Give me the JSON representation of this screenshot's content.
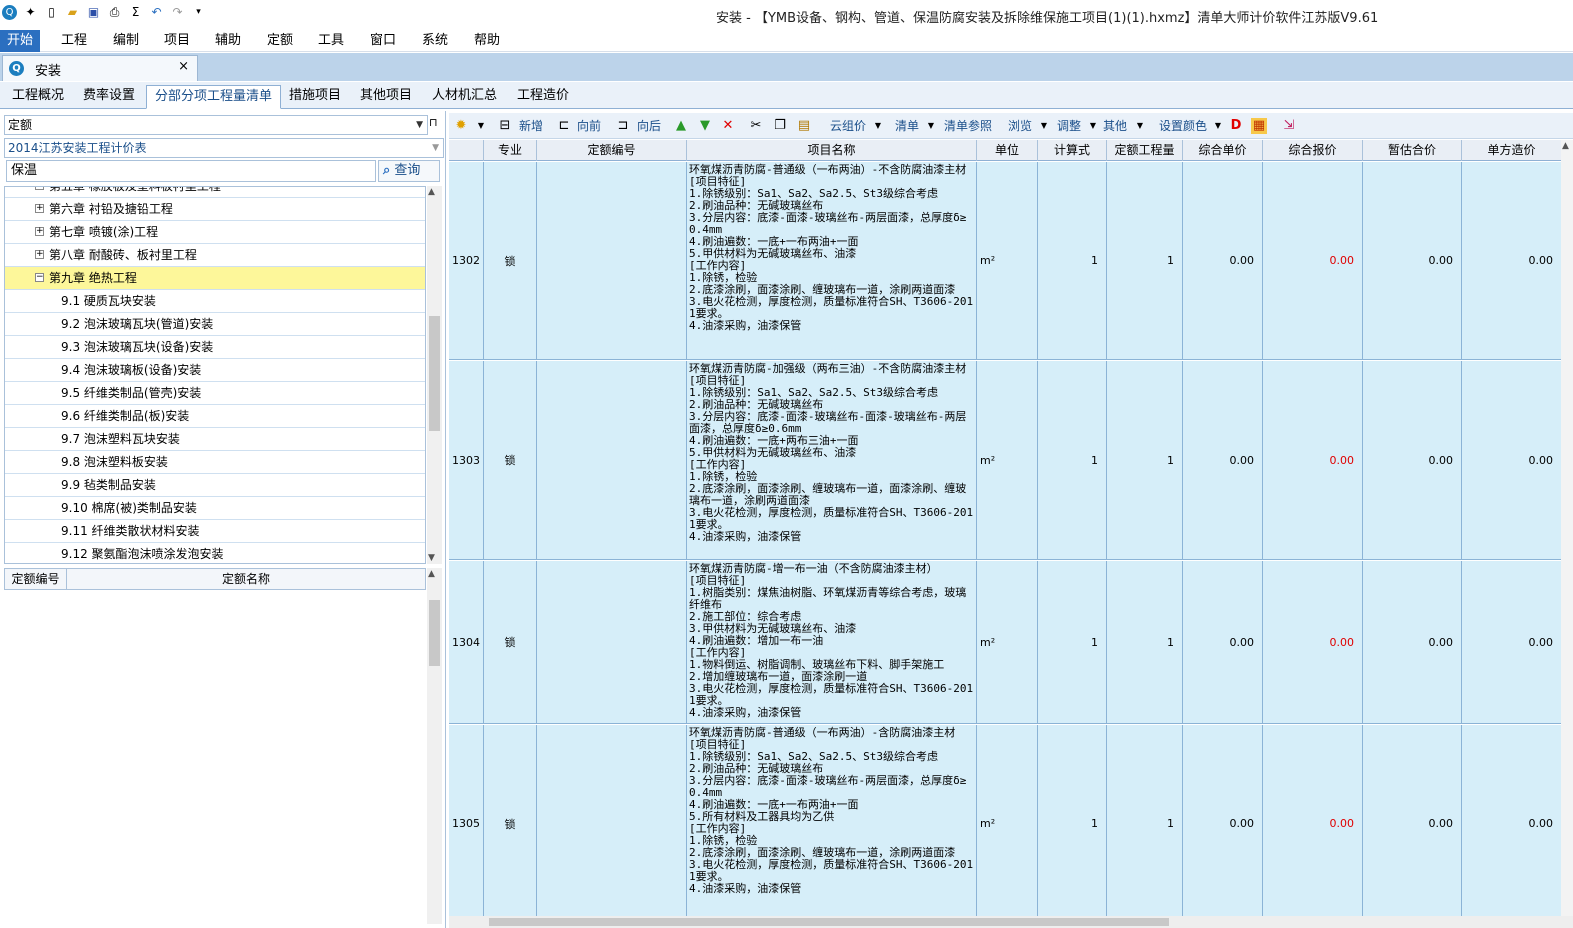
{
  "window": {
    "title": "安装 - 【YMB设备、钢构、管道、保温防腐安装及拆除维保施工项目(1)(1).hxmz】清单大师计价软件江苏版V9.61",
    "quick_access": [
      "app-logo",
      "new-icon",
      "new-doc-icon",
      "open-icon",
      "save-icon",
      "print-icon",
      "sigma-icon",
      "undo-icon",
      "redo-icon",
      "customize-icon"
    ]
  },
  "menu": [
    "开始",
    "工程",
    "编制",
    "项目",
    "辅助",
    "定额",
    "工具",
    "窗口",
    "系统",
    "帮助"
  ],
  "doc_tab": {
    "label": "安装",
    "close": "×"
  },
  "tabs": [
    "工程概况",
    "费率设置",
    "分部分项工程量清单",
    "措施项目",
    "其他项目",
    "人材机汇总",
    "工程造价"
  ],
  "left": {
    "type_combo": "定额",
    "library_combo": "2014江苏安装工程计价表",
    "search_value": "保温",
    "search_button": "查询",
    "tree": [
      {
        "label": "第五章 橡胶板及塑料板衬里工程",
        "level": 0,
        "exp": "+"
      },
      {
        "label": "第六章 衬铅及搪铅工程",
        "level": 0,
        "exp": "+"
      },
      {
        "label": "第七章 喷镀(涂)工程",
        "level": 0,
        "exp": "+"
      },
      {
        "label": "第八章 耐酸砖、板衬里工程",
        "level": 0,
        "exp": "+"
      },
      {
        "label": "第九章 绝热工程",
        "level": 0,
        "exp": "−",
        "selected": true
      },
      {
        "label": "9.1 硬质瓦块安装",
        "level": 1
      },
      {
        "label": "9.2 泡沫玻璃瓦块(管道)安装",
        "level": 1
      },
      {
        "label": "9.3 泡沫玻璃瓦块(设备)安装",
        "level": 1
      },
      {
        "label": "9.4 泡沫玻璃板(设备)安装",
        "level": 1
      },
      {
        "label": "9.5 纤维类制品(管壳)安装",
        "level": 1
      },
      {
        "label": "9.6 纤维类制品(板)安装",
        "level": 1
      },
      {
        "label": "9.7 泡沫塑料瓦块安装",
        "level": 1
      },
      {
        "label": "9.8 泡沫塑料板安装",
        "level": 1
      },
      {
        "label": "9.9 毡类制品安装",
        "level": 1
      },
      {
        "label": "9.10 棉席(被)类制品安装",
        "level": 1
      },
      {
        "label": "9.11 纤维类散状材料安装",
        "level": 1
      },
      {
        "label": "9.12 聚氨酯泡沫喷涂发泡安装",
        "level": 1
      }
    ],
    "quota_headers": [
      "定额编号",
      "定额名称"
    ]
  },
  "toolbar": [
    "新增",
    "向前",
    "向后",
    "云组价",
    "清单",
    "清单参照",
    "浏览",
    "调整",
    "其他",
    "设置颜色"
  ],
  "grid": {
    "headers": [
      "专业",
      "定额编号",
      "项目名称",
      "单位",
      "计算式",
      "定额工程量",
      "综合单价",
      "综合报价",
      "暂估合价",
      "单方造价"
    ],
    "rows": [
      {
        "no": "1302",
        "spec": "锁",
        "code": "",
        "name": "环氧煤沥青防腐-普通级（一布两油）-不含防腐油漆主材\n[项目特征]\n1.除锈级别：Sa1、Sa2、Sa2.5、St3级综合考虑\n2.刷油品种：无碱玻璃丝布\n3.分层内容：底漆-面漆-玻璃丝布-两层面漆，总厚度δ≥0.4mm\n4.刷油遍数：一底+一布两油+一面\n5.甲供材料为无碱玻璃丝布、油漆\n[工作内容]\n1.除锈，检验\n2.底漆涂刷，面漆涂刷、缠玻璃布一道，涂刷两道面漆\n3.电火花检测，厚度检测，质量标准符合SH、T3606-2011要求。\n4.油漆采购，油漆保管",
        "unit": "m²",
        "formula": "1",
        "qty": "1",
        "unit_price": "0.00",
        "quote": "0.00",
        "est": "0.00",
        "unit_cost": "0.00"
      },
      {
        "no": "1303",
        "spec": "锁",
        "code": "",
        "name": "环氧煤沥青防腐-加强级（两布三油）-不含防腐油漆主材\n[项目特征]\n1.除锈级别：Sa1、Sa2、Sa2.5、St3级综合考虑\n2.刷油品种：无碱玻璃丝布\n3.分层内容：底漆-面漆-玻璃丝布-面漆-玻璃丝布-两层面漆，总厚度δ≥0.6mm\n4.刷油遍数：一底+两布三油+一面\n5.甲供材料为无碱玻璃丝布、油漆\n[工作内容]\n1.除锈，检验\n2.底漆涂刷，面漆涂刷、缠玻璃布一道，面漆涂刷、缠玻璃布一道，涂刷两道面漆\n3.电火花检测，厚度检测，质量标准符合SH、T3606-2011要求。\n4.油漆采购，油漆保管",
        "unit": "m²",
        "formula": "1",
        "qty": "1",
        "unit_price": "0.00",
        "quote": "0.00",
        "est": "0.00",
        "unit_cost": "0.00"
      },
      {
        "no": "1304",
        "spec": "锁",
        "code": "",
        "name": "环氧煤沥青防腐-增一布一油（不含防腐油漆主材）\n[项目特征]\n1.树脂类别：煤焦油树脂、环氧煤沥青等综合考虑，玻璃纤维布\n2.施工部位：综合考虑\n3.甲供材料为无碱玻璃丝布、油漆\n4.刷油遍数：增加一布一油\n[工作内容]\n1.物料倒运、树脂调制、玻璃丝布下料、脚手架施工\n2.增加缠玻璃布一道，面漆涂刷一道\n3.电火花检测，厚度检测，质量标准符合SH、T3606-2011要求。\n4.油漆采购，油漆保管",
        "unit": "m²",
        "formula": "1",
        "qty": "1",
        "unit_price": "0.00",
        "quote": "0.00",
        "est": "0.00",
        "unit_cost": "0.00"
      },
      {
        "no": "1305",
        "spec": "锁",
        "code": "",
        "name": "环氧煤沥青防腐-普通级（一布两油）-含防腐油漆主材\n[项目特征]\n1.除锈级别：Sa1、Sa2、Sa2.5、St3级综合考虑\n2.刷油品种：无碱玻璃丝布\n3.分层内容：底漆-面漆-玻璃丝布-两层面漆，总厚度δ≥0.4mm\n4.刷油遍数：一底+一布两油+一面\n5.所有材料及工器具均为乙供\n[工作内容]\n1.除锈，检验\n2.底漆涂刷，面漆涂刷、缠玻璃布一道，涂刷两道面漆\n3.电火花检测，厚度检测，质量标准符合SH、T3606-2011要求。\n4.油漆采购，油漆保管",
        "unit": "m²",
        "formula": "1",
        "qty": "1",
        "unit_price": "0.00",
        "quote": "0.00",
        "est": "0.00",
        "unit_cost": "0.00"
      }
    ]
  },
  "colors": {
    "accent": "#2b6fc0",
    "row_bg": "#d6eef9",
    "tree_selected": "#fdf79a",
    "quote_red": "#e00000"
  }
}
